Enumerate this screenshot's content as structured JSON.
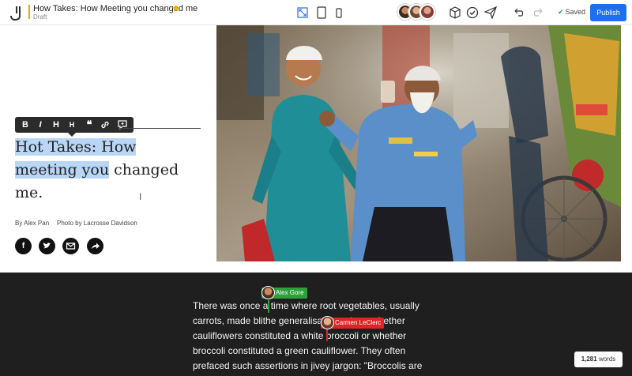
{
  "document": {
    "title": "How Takes: How Meeting you changed me",
    "status": "Draft",
    "star": "★"
  },
  "toolbar": {
    "saved_label": "Saved",
    "publish_label": "Publish"
  },
  "format_bar": {
    "buttons": [
      "B",
      "I",
      "H",
      "H",
      "❝",
      "link",
      "comment"
    ]
  },
  "post": {
    "title_highlighted_1": "Hot Takes: How",
    "title_highlighted_2": "meeting you",
    "title_rest_1": " changed",
    "title_rest_2": "me.",
    "byline": "By Alex Pan",
    "photo_credit": "Photo by Lacrosse Davidson",
    "share": [
      "facebook-icon",
      "twitter-icon",
      "email-icon",
      "share-icon"
    ]
  },
  "collaborators": [
    {
      "name": "Alex Gore",
      "color": "#2aa13a"
    },
    {
      "name": "Carmen LeClerc",
      "color": "#e02424"
    }
  ],
  "body": {
    "line1": "There was once a time where root vegetables, usually",
    "line2": "carrots, made blithe generalisations about whether",
    "line3": "cauliflowers constituted a white broccoli or whether",
    "line4": "broccoli constituted a green cauliflower. They often",
    "line5": "prefaced such assertions in jivey jargon: \"Broccolis are"
  },
  "word_count": {
    "count": "1,281",
    "label": "words"
  },
  "colors": {
    "accent": "#1e6ff0",
    "highlight": "#b9d6f5",
    "dark_bg": "#1f1f1f"
  }
}
